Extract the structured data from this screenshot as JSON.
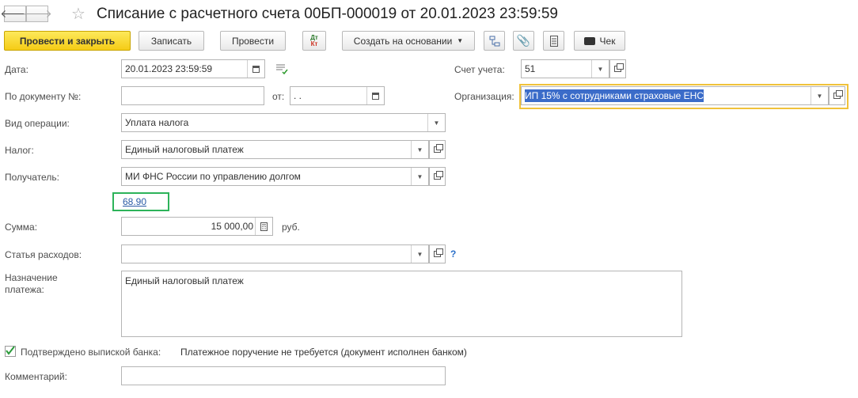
{
  "window": {
    "title": "Списание с расчетного счета 00БП-000019 от 20.01.2023 23:59:59"
  },
  "toolbar": {
    "post_close": "Провести и закрыть",
    "save": "Записать",
    "post": "Провести",
    "dt_kt": "Дт Кт",
    "create_based": "Создать на основании",
    "receipt": "Чек"
  },
  "form": {
    "date_label": "Дата:",
    "date_value": "20.01.2023 23:59:59",
    "doc_number_label": "По документу №:",
    "doc_number_value": "",
    "from_label": "от:",
    "from_value": " .  .",
    "account_label": "Счет учета:",
    "account_value": "51",
    "org_label": "Организация:",
    "org_value": "ИП 15% с сотрудниками страховые ЕНС",
    "operation_label": "Вид операции:",
    "operation_value": "Уплата налога",
    "tax_label": "Налог:",
    "tax_value": "Единый налоговый платеж",
    "recipient_label": "Получатель:",
    "recipient_value": "МИ ФНС России по управлению долгом",
    "account_link": "68.90",
    "sum_label": "Сумма:",
    "sum_value": "15 000,00",
    "currency": "руб.",
    "expense_label": "Статья расходов:",
    "expense_value": "",
    "help": "?",
    "purpose_label": "Назначение платежа:",
    "purpose_value": "Единый налоговый платеж",
    "confirmed_label": "Подтверждено выпиской банка:",
    "confirmed_checked": true,
    "payment_order_note": "Платежное поручение не требуется (документ исполнен банком)",
    "comment_label": "Комментарий:",
    "comment_value": ""
  },
  "colors": {
    "primary_button": "#f5cc16",
    "org_highlight_border": "#f0c23a",
    "link_highlight_border": "#2db35a",
    "selection": "#3b6cc9",
    "link": "#2a5aa5"
  },
  "icons": [
    "arrow-left-icon",
    "arrow-right-icon",
    "star-icon",
    "calendar-icon",
    "dropdown-arrow-icon",
    "open-icon",
    "structure-icon",
    "paperclip-icon",
    "list-icon",
    "cash-register-icon",
    "checkmark-icon"
  ]
}
